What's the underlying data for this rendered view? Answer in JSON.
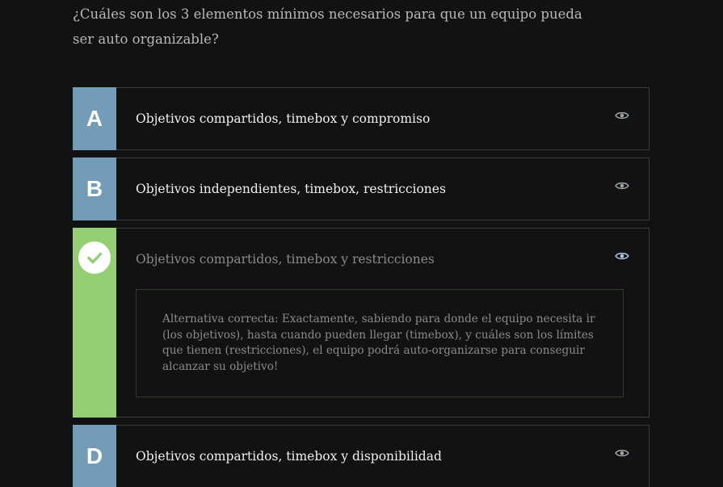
{
  "question": "¿Cuáles son los 3 elementos mínimos necesarios para que un equipo pueda ser auto organizable?",
  "colors": {
    "background": "#121212",
    "letter_default": "#739db6",
    "letter_correct": "#93ce74",
    "border": "#3a3a3a",
    "eye_default": "#9aa4aa",
    "eye_active": "#a9c7e6"
  },
  "options": [
    {
      "letter": "A",
      "text": "Objetivos compartidos, timebox y compromiso",
      "icon": "eye-icon"
    },
    {
      "letter": "B",
      "text": "Objetivos independientes, timebox, restricciones",
      "icon": "eye-icon"
    },
    {
      "letter": "",
      "state": "correct",
      "badge_icon": "checkmark-icon",
      "text": "Objetivos compartidos, timebox y restricciones",
      "icon": "eye-icon",
      "explanation": "Alternativa correcta: Exactamente, sabiendo para donde el equipo necesita ir (los objetivos), hasta cuando pueden llegar (timebox), y cuáles son los límites que tienen (restricciones), el equipo podrá auto-organizarse para conseguir alcanzar su objetivo!"
    },
    {
      "letter": "D",
      "text": "Objetivos compartidos, timebox y disponibilidad",
      "icon": "eye-icon"
    }
  ]
}
